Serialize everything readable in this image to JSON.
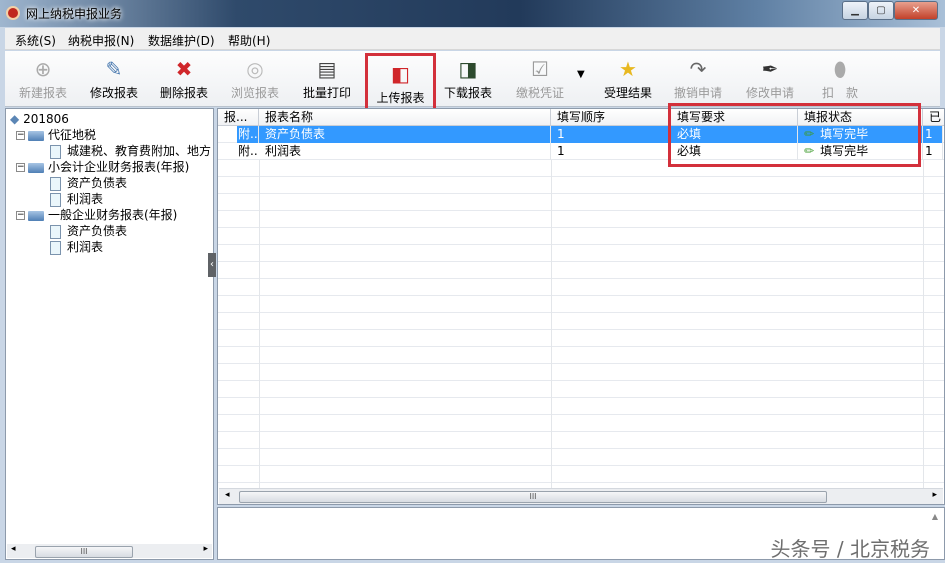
{
  "window": {
    "title": "网上纳税申报业务",
    "controls": [
      "minimize",
      "maximize",
      "close"
    ]
  },
  "menu": [
    "系统(S)",
    "纳税申报(N)",
    "数据维护(D)",
    "帮助(H)"
  ],
  "toolbar": [
    {
      "label": "新建报表",
      "icon": "new-report-icon",
      "enabled": false
    },
    {
      "label": "修改报表",
      "icon": "edit-report-icon",
      "enabled": true
    },
    {
      "label": "删除报表",
      "icon": "delete-report-icon",
      "enabled": true
    },
    {
      "label": "浏览报表",
      "icon": "browse-report-icon",
      "enabled": false
    },
    {
      "label": "批量打印",
      "icon": "print-icon",
      "enabled": true
    },
    {
      "label": "上传报表",
      "icon": "upload-icon",
      "enabled": true,
      "highlighted": true
    },
    {
      "label": "下载报表",
      "icon": "download-icon",
      "enabled": true
    },
    {
      "label": "缴税凭证",
      "icon": "tax-voucher-icon",
      "enabled": false
    },
    {
      "label": "受理结果",
      "icon": "result-icon",
      "enabled": true
    },
    {
      "label": "撤销申请",
      "icon": "revoke-icon",
      "enabled": false
    },
    {
      "label": "修改申请",
      "icon": "modify-request-icon",
      "enabled": false
    },
    {
      "label": "扣　款",
      "icon": "deduct-icon",
      "enabled": false
    }
  ],
  "tree": {
    "root": "201806",
    "groups": [
      {
        "label": "代征地税",
        "items": [
          "城建税、教育费附加、地方"
        ]
      },
      {
        "label": "小会计企业财务报表(年报)",
        "items": [
          "资产负债表",
          "利润表"
        ]
      },
      {
        "label": "一般企业财务报表(年报)",
        "items": [
          "资产负债表",
          "利润表"
        ]
      }
    ]
  },
  "grid": {
    "columns": [
      "报...",
      "报表名称",
      "填写顺序",
      "填写要求",
      "填报状态",
      "已"
    ],
    "rows": [
      {
        "type": "附..",
        "name": "资产负债表",
        "order": "1",
        "requirement": "必填",
        "status": "填写完毕",
        "extra": "1",
        "selected": true
      },
      {
        "type": "附..",
        "name": "利润表",
        "order": "1",
        "requirement": "必填",
        "status": "填写完毕",
        "extra": "1",
        "selected": false
      }
    ]
  },
  "watermark": "头条号 / 北京税务",
  "colors": {
    "selection": "#3399ff",
    "highlight_box": "#d3303b"
  }
}
